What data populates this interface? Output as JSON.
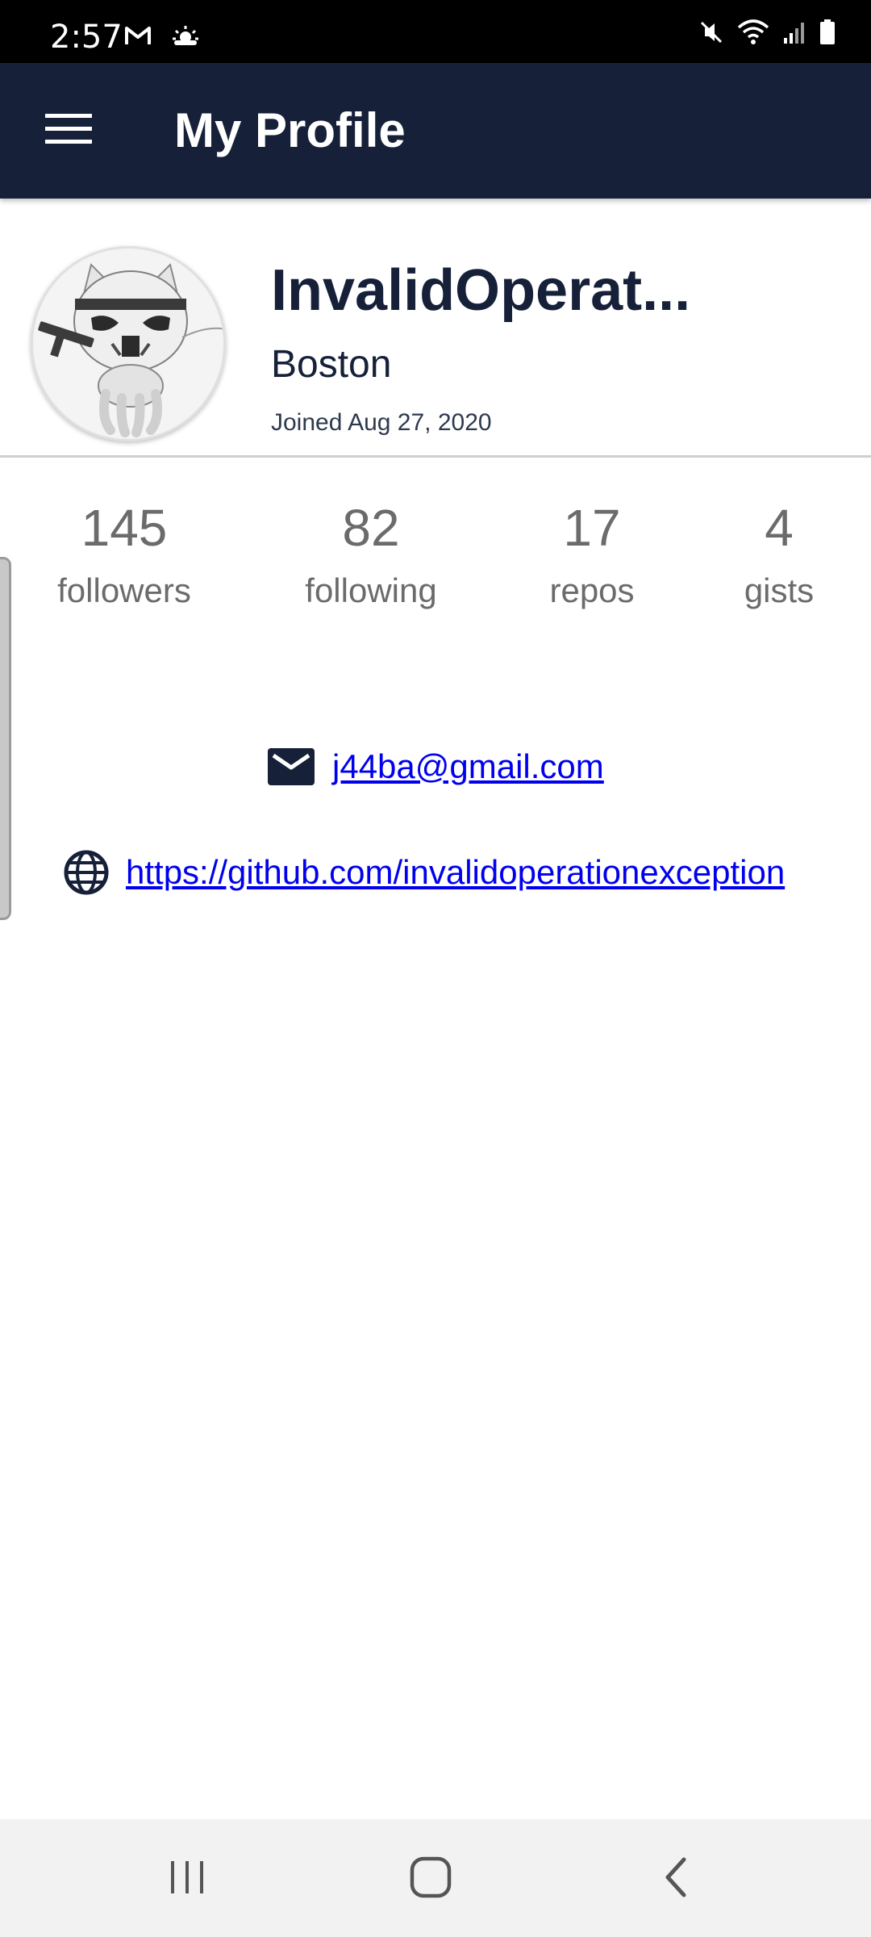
{
  "status_bar": {
    "time": "2:57",
    "left_icons": [
      "gmail-icon",
      "weather-icon"
    ],
    "right_icons": [
      "mute-icon",
      "wifi-icon",
      "signal-icon",
      "battery-icon"
    ]
  },
  "app_bar": {
    "title": "My Profile",
    "menu_icon": "hamburger-menu-icon"
  },
  "profile": {
    "name": "InvalidOperat...",
    "location": "Boston",
    "joined": "Joined Aug 27, 2020"
  },
  "stats": [
    {
      "value": "145",
      "label": "followers"
    },
    {
      "value": "82",
      "label": "following"
    },
    {
      "value": "17",
      "label": "repos"
    },
    {
      "value": "4",
      "label": "gists"
    }
  ],
  "contact": {
    "email": "j44ba@gmail.com",
    "website": "https://github.com/invalidoperationexception"
  },
  "colors": {
    "app_bar": "#162039",
    "link": "#0000ee",
    "stat_text": "#6b6b6b"
  }
}
